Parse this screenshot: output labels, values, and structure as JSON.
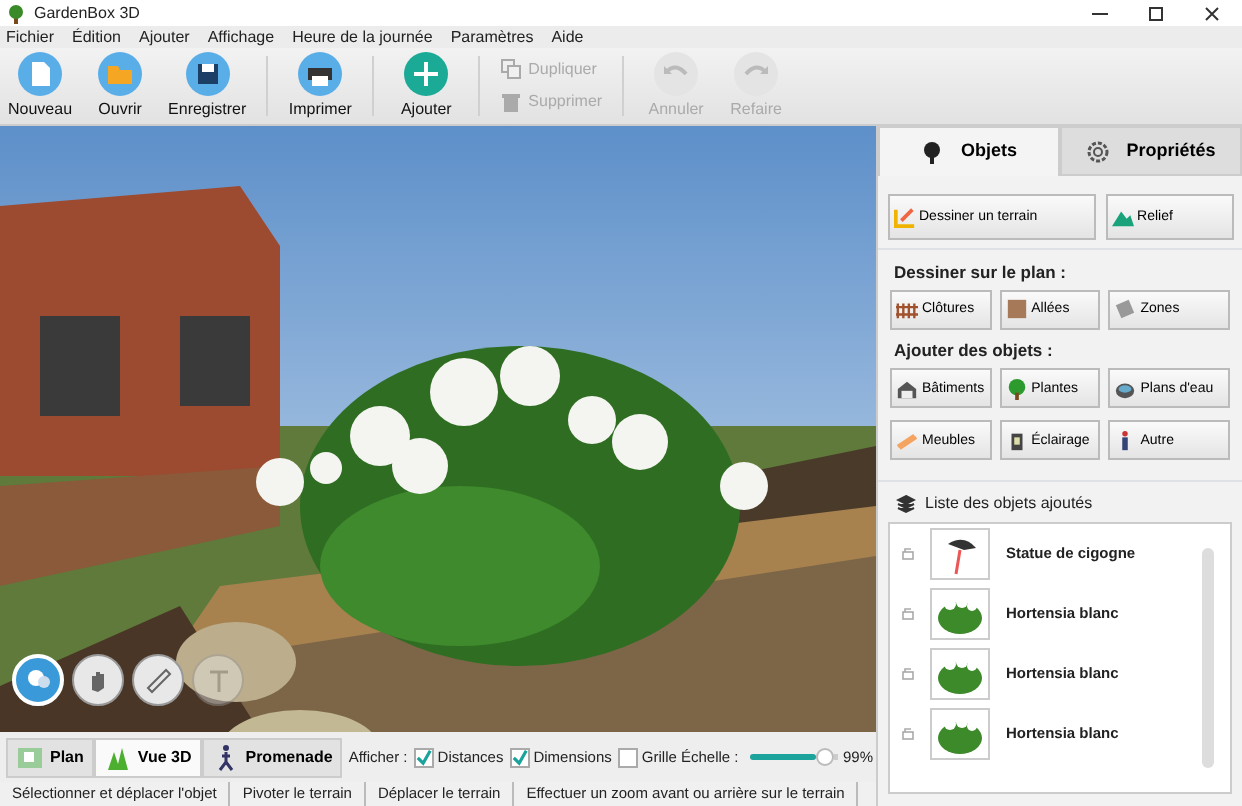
{
  "window": {
    "title": "GardenBox 3D"
  },
  "menu": [
    "Fichier",
    "Édition",
    "Ajouter",
    "Affichage",
    "Heure de la journée",
    "Paramètres",
    "Aide"
  ],
  "toolbar": [
    {
      "label": "Nouveau",
      "kind": "big",
      "disabled": false
    },
    {
      "label": "Ouvrir",
      "kind": "big",
      "disabled": false
    },
    {
      "label": "Enregistrer",
      "kind": "big",
      "disabled": false
    },
    {
      "label": "Imprimer",
      "kind": "big",
      "disabled": false
    },
    {
      "label": "Ajouter",
      "kind": "big",
      "disabled": false
    },
    {
      "label": "Dupliquer",
      "kind": "small",
      "disabled": true
    },
    {
      "label": "Supprimer",
      "kind": "small",
      "disabled": true
    },
    {
      "label": "Annuler",
      "kind": "big",
      "disabled": true
    },
    {
      "label": "Refaire",
      "kind": "big",
      "disabled": true
    }
  ],
  "view_tools": [
    {
      "selected": true,
      "disabled": false
    },
    {
      "selected": false,
      "disabled": false
    },
    {
      "selected": false,
      "disabled": false
    },
    {
      "selected": false,
      "disabled": true
    }
  ],
  "view_modes": [
    {
      "label": "Plan",
      "selected": false
    },
    {
      "label": "Vue 3D",
      "selected": true
    },
    {
      "label": "Promenade",
      "selected": false
    }
  ],
  "display": {
    "label": "Afficher :",
    "options": [
      {
        "label": "Distances",
        "checked": true
      },
      {
        "label": "Dimensions",
        "checked": true
      },
      {
        "label": "Grille Échelle :",
        "checked": false
      }
    ],
    "slider": {
      "level": 0.95,
      "reading": "99%"
    }
  },
  "status_bar": [
    "Sélectionner et déplacer l'objet",
    "Pivoter le terrain",
    "Déplacer le terrain",
    "Effectuer un zoom avant ou arrière sur le terrain"
  ],
  "tabs": [
    {
      "label": "Objets",
      "selected": true
    },
    {
      "label": "Propriétés",
      "selected": false
    }
  ],
  "terrain_buttons": [
    "Dessiner un terrain",
    "Relief"
  ],
  "plan_section": {
    "heading": "Dessiner sur le plan :",
    "buttons": [
      "Clôtures",
      "Allées",
      "Zones"
    ]
  },
  "objects_section": {
    "heading": "Ajouter des objets :",
    "buttons": [
      "Bâtiments",
      "Plantes",
      "Plans d'eau",
      "Meubles",
      "Éclairage",
      "Autre"
    ]
  },
  "object_list": {
    "heading": "Liste des objets ajoutés",
    "items": [
      {
        "name": "Statue de cigogne",
        "kind": "statue"
      },
      {
        "name": "Hortensia blanc",
        "kind": "plant"
      },
      {
        "name": "Hortensia blanc",
        "kind": "plant"
      },
      {
        "name": "Hortensia blanc",
        "kind": "plant"
      }
    ]
  }
}
